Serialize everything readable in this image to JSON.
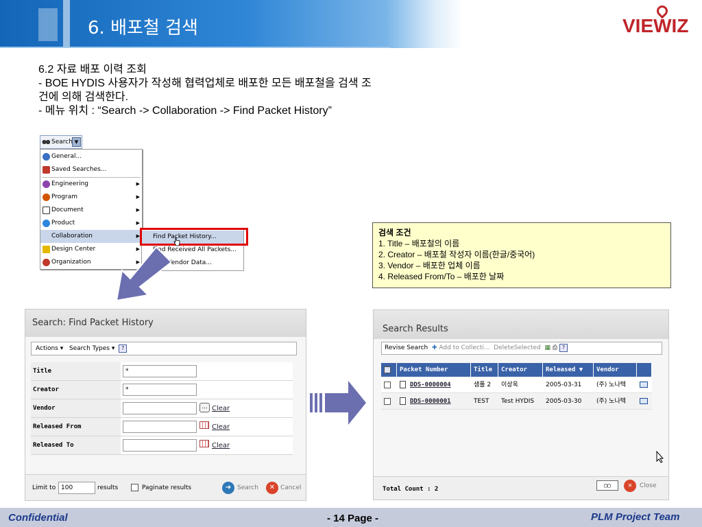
{
  "slide": {
    "title": "6. 배포철 검색",
    "logo": "VIEWIZ"
  },
  "intro": {
    "lines": [
      "6.2  자료 배포 이력 조회",
      "- BOE HYDIS 사용자가 작성해 협력업체로 배포한 모든 배포철을 검색 조",
      "건에 의해 검색한다.",
      "- 메뉴 위치 : “Search -> Collaboration -> Find Packet History”"
    ]
  },
  "menu": {
    "button_label": "Search",
    "items": [
      {
        "label": "General...",
        "icon": "globe-icon",
        "color": "#3a6fc4"
      },
      {
        "label": "Saved Searches...",
        "icon": "folder-icon",
        "color": "#c0392b"
      },
      {
        "label": "Engineering",
        "icon": "gear-icon",
        "color": "#8e44ad",
        "submenu": true
      },
      {
        "label": "Program",
        "icon": "gear-icon",
        "color": "#d35400",
        "submenu": true
      },
      {
        "label": "Document",
        "icon": "document-icon",
        "color": "#ffffff",
        "submenu": true
      },
      {
        "label": "Product",
        "icon": "cube-icon",
        "color": "#2e86de",
        "submenu": true
      },
      {
        "label": "Collaboration",
        "icon": "none",
        "color": "#c9d6ea",
        "submenu": true,
        "selected": true
      },
      {
        "label": "Design Center",
        "icon": "box-icon",
        "color": "#e6b800",
        "submenu": true
      },
      {
        "label": "Organization",
        "icon": "org-icon",
        "color": "#c0392b",
        "submenu": true
      }
    ],
    "submenu_items": [
      {
        "label": "Find Packet History...",
        "selected": true
      },
      {
        "label": "Find Received All Packets..."
      },
      {
        "label": "Find Vendor Data..."
      }
    ]
  },
  "note": {
    "title": "검색 조건",
    "lines": [
      "1. Title – 배포철의 이름",
      "2. Creator – 배포철 작성자 이름(한글/중국어)",
      "3. Vendor – 배포한 업체 이름",
      "4. Released From/To – 배포한 날짜"
    ]
  },
  "find_panel": {
    "title": "Search: Find Packet History",
    "toolbar": {
      "actions": "Actions ▾",
      "search_types": "Search Types ▾"
    },
    "fields": [
      {
        "label": "Title",
        "value": "*",
        "picker": "none"
      },
      {
        "label": "Creator",
        "value": "*",
        "picker": "none"
      },
      {
        "label": "Vendor",
        "value": "",
        "picker": "dots",
        "clear": "Clear"
      },
      {
        "label": "Released From",
        "value": "",
        "picker": "calendar",
        "clear": "Clear"
      },
      {
        "label": "Released To",
        "value": "",
        "picker": "calendar",
        "clear": "Clear"
      }
    ],
    "footer": {
      "limit_label": "Limit to",
      "limit_value": "100",
      "results_label": "results",
      "paginate_label": "Paginate results",
      "search_label": "Search",
      "cancel_label": "Cancel"
    }
  },
  "results_panel": {
    "title": "Search Results",
    "toolbar": {
      "revise": "Revise Search",
      "add": "Add to Collecti...",
      "delete": "DeleteSelected"
    },
    "columns": [
      "Packet Number",
      "Title",
      "Creator",
      "Released ▼",
      "Vendor"
    ],
    "rows": [
      {
        "packet": "DDS-0000004",
        "title": "샘플 2",
        "creator": "이상욱",
        "released": "2005-03-31",
        "vendor": "(주) 노나텍"
      },
      {
        "packet": "DDS-0000001",
        "title": "TEST",
        "creator": "Test HYDIS",
        "released": "2005-03-30",
        "vendor": "(주) 노나텍"
      }
    ],
    "footer": {
      "total": "Total Count : 2",
      "close_label": "Close"
    }
  },
  "footer": {
    "left": "Confidential",
    "center": "- 14 Page -",
    "right": "PLM  Project Team"
  },
  "colors": {
    "header_blue": "#1466b8",
    "logo_red": "#c0252a",
    "highlight_red": "#e00000",
    "note_yellow": "#ffffcc",
    "table_header": "#3a62a8",
    "footer_band": "#c6cbdc",
    "footer_text": "#1c3a8a",
    "arrow": "#6b6fb0"
  }
}
